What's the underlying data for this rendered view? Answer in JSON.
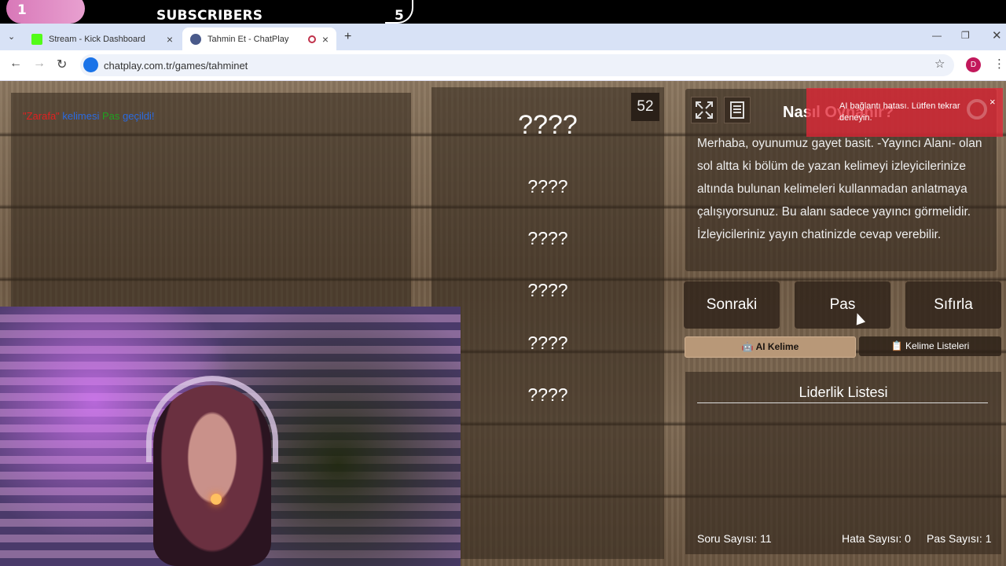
{
  "overlay": {
    "left_number": "1",
    "label": "SUBSCRIBERS",
    "right_number": "5"
  },
  "browser": {
    "tabs": [
      {
        "title": "Stream - Kick Dashboard",
        "active": false,
        "favicon_color": "#53fc18"
      },
      {
        "title": "Tahmin Et - ChatPlay",
        "active": true,
        "favicon_color": "#4a5a8a"
      }
    ],
    "url": "chatplay.com.tr/games/tahminet",
    "profile_initial": "D"
  },
  "chat": {
    "word": "\"Zarafa\"",
    "text1": " kelimesi ",
    "pass": "Pas",
    "text2": " geçildi!",
    "word_color": "#e02020",
    "text_color": "#2a6ae0",
    "pass_color": "#20a020"
  },
  "game": {
    "timer": "52",
    "main_word": "????",
    "forbidden_words": [
      "????",
      "????",
      "????",
      "????",
      "????"
    ]
  },
  "info": {
    "title": "Nasıl Oynanır?",
    "text": "Merhaba, oyunumuz gayet basit. -Yayıncı Alanı- olan sol altta ki bölüm de yazan kelimeyi izleyicilerinize altında bulunan kelimeleri kullanmadan anlatmaya çalışıyorsunuz. Bu alanı sadece yayıncı görmelidir. İzleyicileriniz yayın chatinizde cevap verebilir."
  },
  "toast": {
    "message": "AI bağlantı hatası. Lütfen tekrar deneyin.",
    "close": "×"
  },
  "controls": {
    "next": "Sonraki",
    "pass": "Pas",
    "reset": "Sıfırla",
    "ai_word": "🤖 AI Kelime",
    "word_lists": "📋 Kelime Listeleri"
  },
  "leaderboard": {
    "title": "Liderlik Listesi",
    "question_count": "Soru Sayısı: 11",
    "error_count": "Hata Sayısı: 0",
    "pass_count": "Pas Sayısı: 1"
  }
}
